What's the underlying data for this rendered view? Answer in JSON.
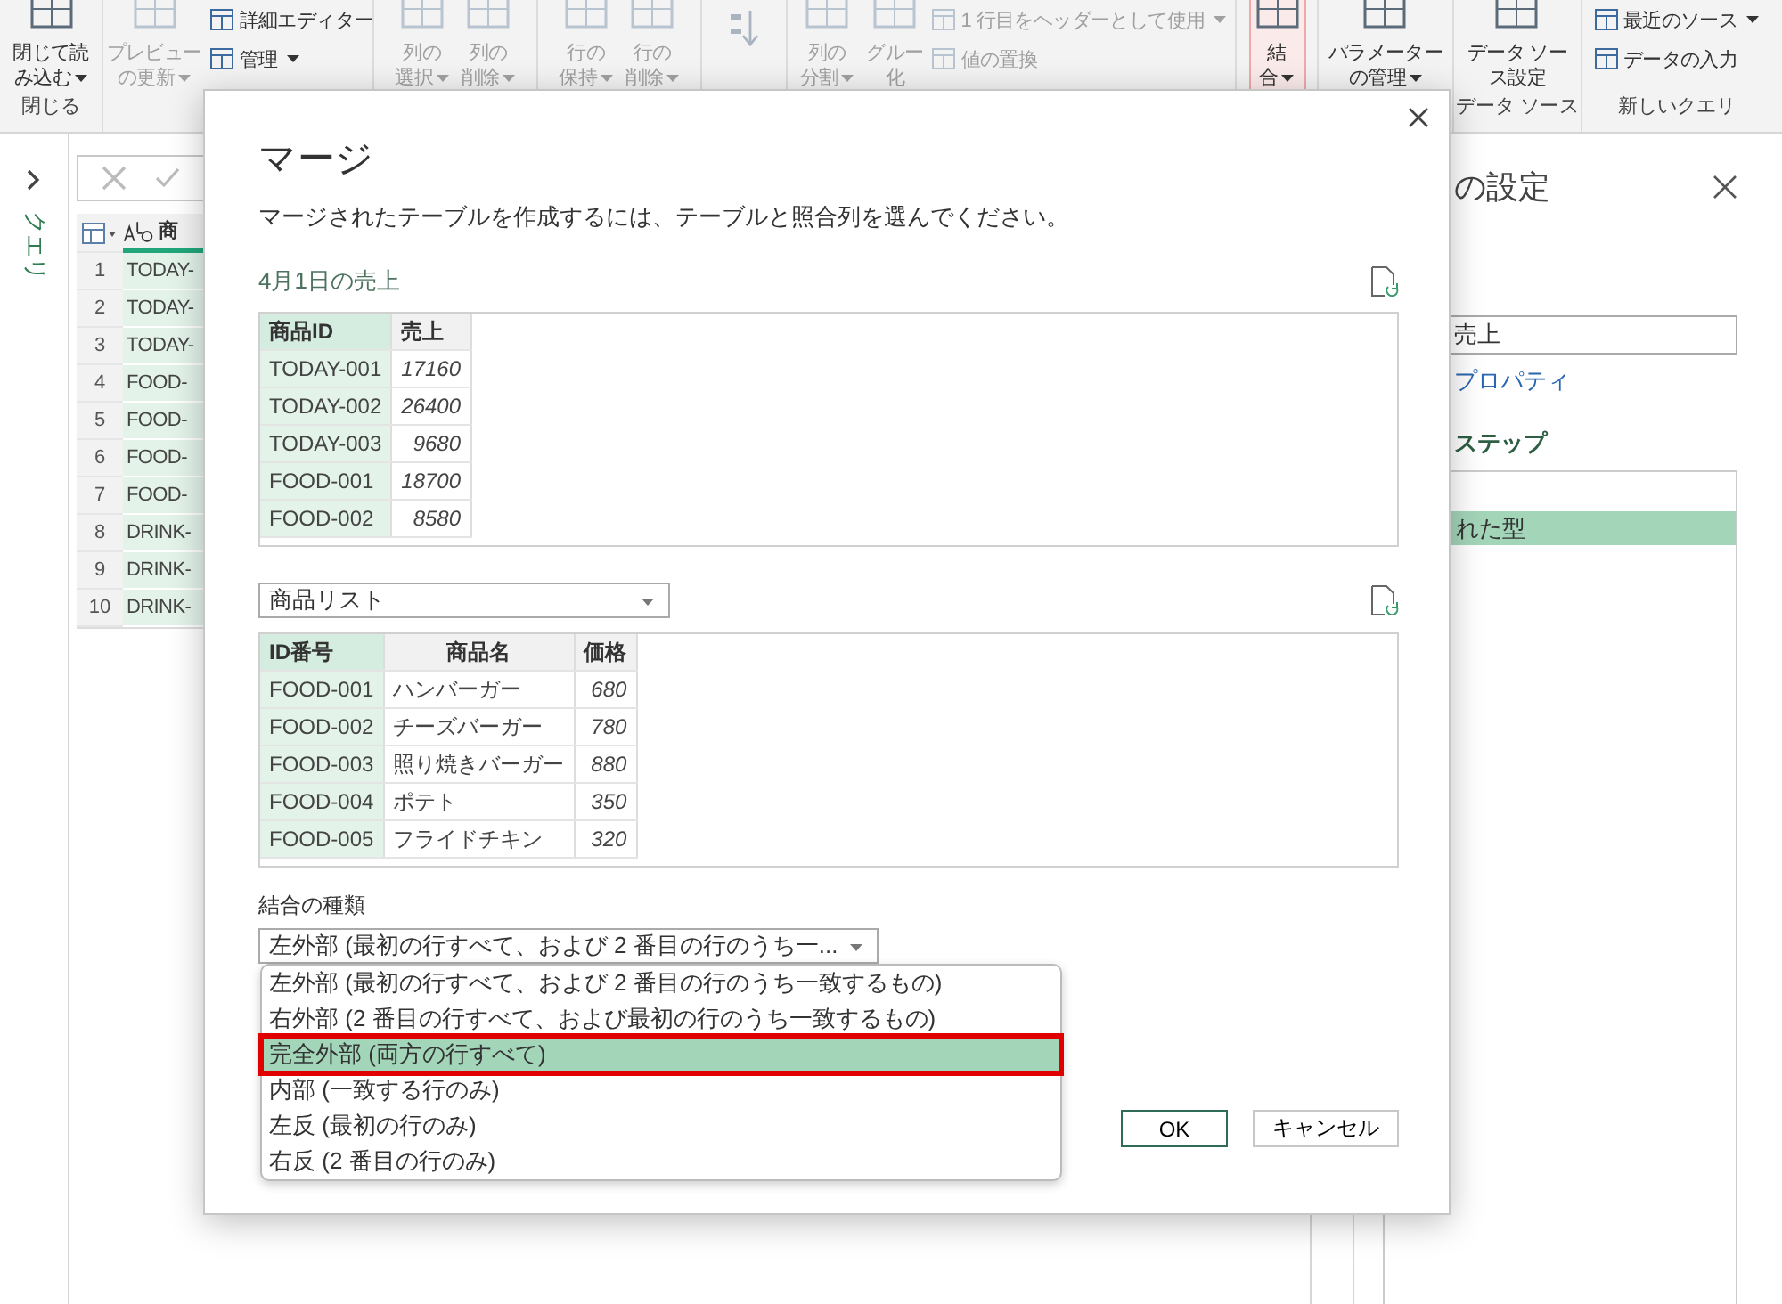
{
  "ribbon": {
    "groups": [
      {
        "label": "閉じる",
        "items": [
          {
            "kind": "large",
            "lines": [
              "閉じて読",
              "み込む"
            ],
            "menu": true,
            "disabled": false,
            "active": false
          }
        ]
      },
      {
        "items": [
          {
            "kind": "large",
            "lines": [
              "プレビュー",
              "の更新"
            ],
            "menu": true,
            "disabled": true,
            "active": false
          },
          {
            "kind": "stack",
            "items": [
              {
                "label": "詳細エディター",
                "menu": false,
                "disabled": false
              },
              {
                "label": "管理",
                "menu": true,
                "disabled": false
              }
            ]
          }
        ]
      },
      {
        "items": [
          {
            "kind": "large",
            "lines": [
              "列の",
              "選択"
            ],
            "menu": true,
            "disabled": true,
            "active": false
          },
          {
            "kind": "large",
            "lines": [
              "列の",
              "削除"
            ],
            "menu": true,
            "disabled": true,
            "active": false
          }
        ]
      },
      {
        "items": [
          {
            "kind": "large",
            "lines": [
              "行の",
              "保持"
            ],
            "menu": true,
            "disabled": true,
            "active": false
          },
          {
            "kind": "large",
            "lines": [
              "行の",
              "削除"
            ],
            "menu": true,
            "disabled": true,
            "active": false
          }
        ]
      },
      {
        "items": [
          {
            "kind": "sort",
            "disabled": true
          }
        ]
      },
      {
        "items": [
          {
            "kind": "large",
            "lines": [
              "列の",
              "分割"
            ],
            "menu": true,
            "disabled": true,
            "active": false
          },
          {
            "kind": "large",
            "lines": [
              "グルー",
              "化"
            ],
            "menu": false,
            "disabled": true,
            "active": false
          },
          {
            "kind": "stack",
            "items": [
              {
                "label": "1 行目をヘッダーとして使用",
                "menu": true,
                "disabled": true
              },
              {
                "label": "値の置換",
                "menu": false,
                "disabled": true
              }
            ]
          }
        ]
      },
      {
        "items": [
          {
            "kind": "large",
            "lines": [
              "結",
              "合"
            ],
            "menu": true,
            "disabled": false,
            "active": true
          }
        ]
      },
      {
        "items": [
          {
            "kind": "large",
            "lines": [
              "パラメーター",
              "の管理"
            ],
            "menu": true,
            "disabled": false,
            "active": false
          }
        ]
      },
      {
        "label": "データ ソース",
        "items": [
          {
            "kind": "large",
            "lines": [
              "データ ソー",
              "ス設定"
            ],
            "menu": false,
            "disabled": false,
            "active": false
          }
        ]
      },
      {
        "label": "新しいクエリ",
        "items": [
          {
            "kind": "stack",
            "items": [
              {
                "label": "最近のソース",
                "menu": true,
                "disabled": false
              },
              {
                "label": "データの入力",
                "menu": false,
                "disabled": false
              }
            ]
          }
        ]
      }
    ]
  },
  "queries_pane": {
    "label": "クエリ"
  },
  "grid": {
    "header": "商",
    "rows": [
      {
        "number": "1",
        "value": "TODAY-"
      },
      {
        "number": "2",
        "value": "TODAY-"
      },
      {
        "number": "3",
        "value": "TODAY-"
      },
      {
        "number": "4",
        "value": "FOOD-"
      },
      {
        "number": "5",
        "value": "FOOD-"
      },
      {
        "number": "6",
        "value": "FOOD-"
      },
      {
        "number": "7",
        "value": "FOOD-"
      },
      {
        "number": "8",
        "value": "DRINK-"
      },
      {
        "number": "9",
        "value": "DRINK-"
      },
      {
        "number": "10",
        "value": "DRINK-"
      }
    ]
  },
  "query_settings": {
    "title": "の設定",
    "name_value": "売上",
    "properties_link": "プロパティ",
    "steps_heading": "ステップ",
    "steps": [
      {
        "label": "れた型",
        "selected": true
      }
    ]
  },
  "dialog": {
    "title": "マージ",
    "description": "マージされたテーブルを作成するには、テーブルと照合列を選んでください。",
    "first_table": {
      "caption": "4月1日の売上",
      "columns": [
        {
          "label": "商品ID",
          "kind": "key"
        },
        {
          "label": "売上",
          "kind": "number"
        }
      ],
      "rows": [
        [
          "TODAY-001",
          "17160"
        ],
        [
          "TODAY-002",
          "26400"
        ],
        [
          "TODAY-003",
          "9680"
        ],
        [
          "FOOD-001",
          "18700"
        ],
        [
          "FOOD-002",
          "8580"
        ]
      ]
    },
    "second_table": {
      "source": "商品リスト",
      "columns": [
        {
          "label": "ID番号",
          "kind": "key"
        },
        {
          "label": "商品名",
          "kind": "text"
        },
        {
          "label": "価格",
          "kind": "number"
        }
      ],
      "rows": [
        [
          "FOOD-001",
          "ハンバーガー",
          "680"
        ],
        [
          "FOOD-002",
          "チーズバーガー",
          "780"
        ],
        [
          "FOOD-003",
          "照り焼きバーガー",
          "880"
        ],
        [
          "FOOD-004",
          "ポテト",
          "350"
        ],
        [
          "FOOD-005",
          "フライドチキン",
          "320"
        ]
      ]
    },
    "join_kind": {
      "label": "結合の種類",
      "value": "左外部 (最初の行すべて、および 2 番目の行のうち一...",
      "options": [
        {
          "label": "左外部 (最初の行すべて、および 2 番目の行のうち一致するもの)",
          "selected": false,
          "highlighted": false
        },
        {
          "label": "右外部 (2 番目の行すべて、および最初の行のうち一致するもの)",
          "selected": false,
          "highlighted": false
        },
        {
          "label": "完全外部 (両方の行すべて)",
          "selected": true,
          "highlighted": true
        },
        {
          "label": "内部 (一致する行のみ)",
          "selected": false,
          "highlighted": false
        },
        {
          "label": "左反 (最初の行のみ)",
          "selected": false,
          "highlighted": false
        },
        {
          "label": "右反 (2 番目の行のみ)",
          "selected": false,
          "highlighted": false
        }
      ]
    },
    "buttons": [
      {
        "label": "OK",
        "primary": true
      },
      {
        "label": "キャンセル",
        "primary": false
      }
    ]
  }
}
